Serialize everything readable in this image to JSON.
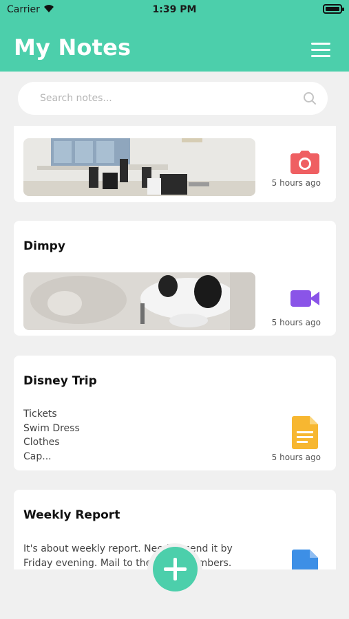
{
  "status": {
    "carrier": "Carrier",
    "time": "1:39 PM"
  },
  "header": {
    "title": "My Notes"
  },
  "search": {
    "placeholder": "Search notes..."
  },
  "notes": [
    {
      "title": "",
      "type": "photo",
      "icon": "camera-icon",
      "icon_color": "#ef5f62",
      "time": "5 hours ago"
    },
    {
      "title": "Dimpy",
      "type": "video",
      "icon": "video-icon",
      "icon_color": "#8a54e8",
      "time": "5 hours ago"
    },
    {
      "title": "Disney Trip",
      "type": "text",
      "icon": "document-icon",
      "icon_color": "#f7b731",
      "body": [
        "Tickets",
        "Swim Dress",
        "Clothes",
        "Cap..."
      ],
      "time": "5 hours ago"
    },
    {
      "title": "Weekly Report",
      "type": "text",
      "icon": "document-icon",
      "icon_color": "#3d8fe6",
      "body": [
        "It's about weekly report. Need to send it by",
        "Friday evening. Mail to the team members."
      ]
    }
  ],
  "colors": {
    "accent": "#4ccfab",
    "background": "#f0f0f0"
  }
}
